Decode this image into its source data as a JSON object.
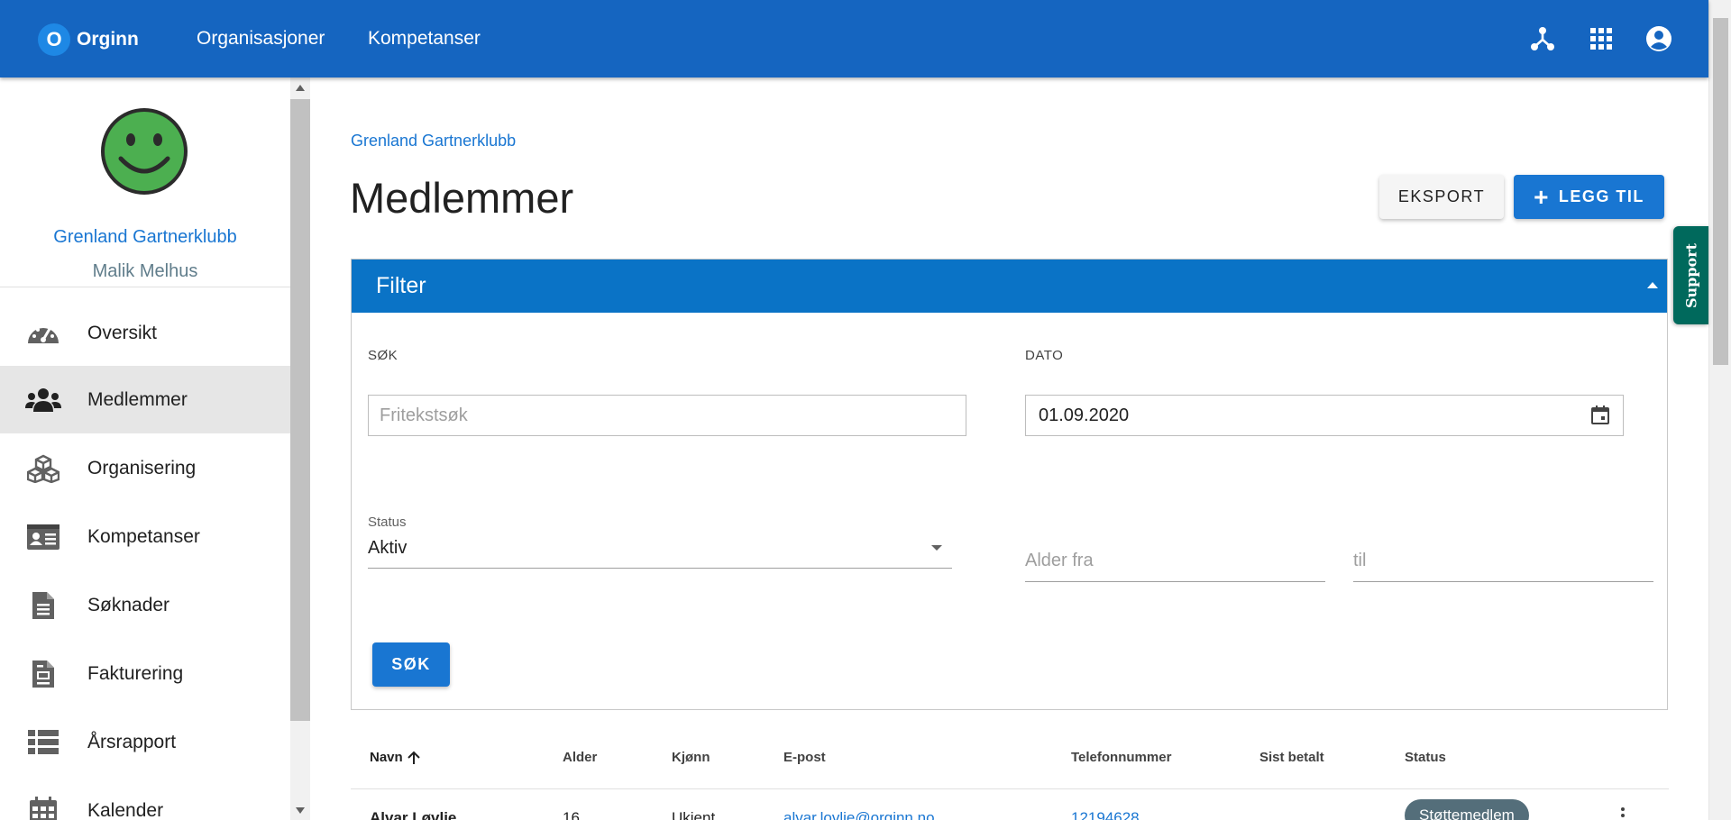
{
  "topbar": {
    "logo_letter": "O",
    "logo_text": "Orginn",
    "nav": [
      "Organisasjoner",
      "Kompetanser"
    ],
    "icons": [
      "organization-tree-icon",
      "apps-grid-icon",
      "account-circle-icon"
    ]
  },
  "sidebar": {
    "avatar_icon": "smiley-face-icon",
    "org_name": "Grenland Gartnerklubb",
    "user_name": "Malik Melhus",
    "items": [
      {
        "label": "Oversikt",
        "icon": "dashboard-gauge-icon",
        "active": false
      },
      {
        "label": "Medlemmer",
        "icon": "people-group-icon",
        "active": true
      },
      {
        "label": "Organisering",
        "icon": "cubes-icon",
        "active": false
      },
      {
        "label": "Kompetanser",
        "icon": "id-card-icon",
        "active": false
      },
      {
        "label": "Søknader",
        "icon": "document-icon",
        "active": false
      },
      {
        "label": "Fakturering",
        "icon": "invoice-icon",
        "active": false
      },
      {
        "label": "Årsrapport",
        "icon": "list-icon",
        "active": false
      },
      {
        "label": "Kalender",
        "icon": "calendar-icon",
        "active": false
      }
    ]
  },
  "main": {
    "breadcrumb": "Grenland Gartnerklubb",
    "title": "Medlemmer",
    "export_label": "EKSPORT",
    "add_label": "LEGG TIL",
    "support_label": "Support"
  },
  "filter": {
    "title": "Filter",
    "search_label": "SØK",
    "search_placeholder": "Fritekstsøk",
    "search_value": "",
    "date_label": "DATO",
    "date_value": "01.09.2020",
    "status_label": "Status",
    "status_value": "Aktiv",
    "age_from_placeholder": "Alder fra",
    "age_to_placeholder": "til",
    "search_button": "SØK"
  },
  "table": {
    "headers": [
      "Navn",
      "Alder",
      "Kjønn",
      "E-post",
      "Telefonnummer",
      "Sist betalt",
      "Status"
    ],
    "rows": [
      {
        "name": "Alvar Løvlie",
        "age": "16",
        "gender": "Ukjent",
        "email": "alvar.lovlie@orginn.no",
        "phone": "12194628",
        "last_paid": "",
        "status": "Støttemedlem"
      }
    ]
  },
  "colors": {
    "topbar": "#1565c0",
    "accent": "#1976d2",
    "filter_header": "#0a73c6",
    "support": "#00695c",
    "avatar": "#4caf50"
  }
}
